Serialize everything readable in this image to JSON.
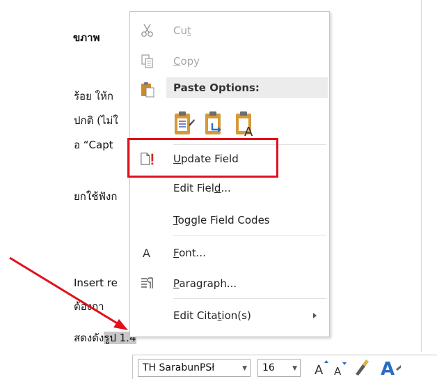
{
  "document": {
    "lines": [
      "ขภาพ",
      "ร้อย ให้ก",
      "ปกติ (ไม่ใ",
      "อ “Capt",
      "ยกใช้ฟังก",
      "Insert re",
      "ต้องกา",
      "สดงดัง",
      "รูป 1.4"
    ]
  },
  "context_menu": {
    "cut": {
      "prefix": "Cu",
      "accel": "t",
      "suffix": ""
    },
    "copy": {
      "prefix": "",
      "accel": "C",
      "suffix": "opy"
    },
    "paste_options": "Paste Options:",
    "update_field": {
      "prefix": "",
      "accel": "U",
      "suffix": "pdate Field"
    },
    "edit_field": {
      "prefix": "Edit Fiel",
      "accel": "d",
      "suffix": "..."
    },
    "toggle_field_codes": {
      "prefix": "",
      "accel": "T",
      "suffix": "oggle Field Codes"
    },
    "font": {
      "prefix": "",
      "accel": "F",
      "suffix": "ont..."
    },
    "paragraph": {
      "prefix": "",
      "accel": "P",
      "suffix": "aragraph..."
    },
    "edit_citations": {
      "prefix": "Edit Cita",
      "accel": "t",
      "suffix": "ion(s)"
    }
  },
  "toolbar": {
    "font_name": "TH SarabunPSł",
    "font_size": "16"
  },
  "colors": {
    "highlight_red": "#e2101c",
    "paste_head_bg": "#ececec",
    "disabled_text": "#a6a6a6"
  }
}
